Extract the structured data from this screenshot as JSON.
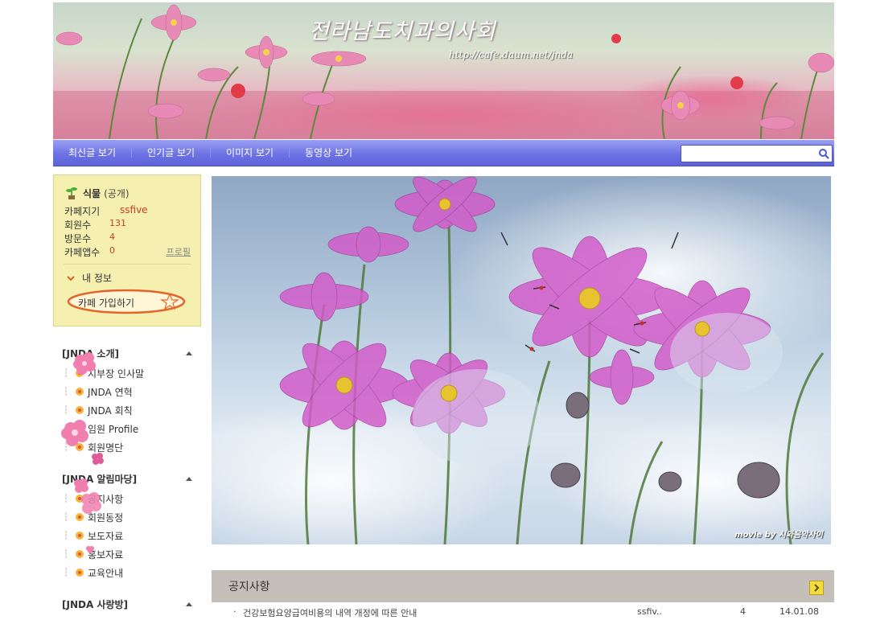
{
  "header": {
    "title": "전라남도치과의사회",
    "url": "http://cafe.daum.net/jnda"
  },
  "nav": {
    "items": [
      "최신글 보기",
      "인기글 보기",
      "이미지 보기",
      "동영상 보기"
    ],
    "search_placeholder": ""
  },
  "profile": {
    "level": "식물",
    "visibility": "(공개)",
    "rows": [
      {
        "label": "카페지기",
        "value": "ssfive"
      },
      {
        "label": "회원수",
        "value": "131"
      },
      {
        "label": "방문수",
        "value": "4"
      },
      {
        "label": "카페앱수",
        "value": "0"
      }
    ],
    "profile_link": "프로필",
    "my_info": "내 정보",
    "join_button": "카페 가입하기"
  },
  "sidebar": {
    "groups": [
      {
        "title": "[JNDA 소개]",
        "items": [
          "지부장 인사말",
          "JNDA 연혁",
          "JNDA 회칙",
          "임원 Profile",
          "회원명단"
        ]
      },
      {
        "title": "[JNDA 알림마당]",
        "items": [
          "공지사항",
          "회원동정",
          "보도자료",
          "홍보자료",
          "교육안내"
        ]
      },
      {
        "title": "[JNDA 사랑방]",
        "items": []
      }
    ]
  },
  "hero": {
    "credit": "movie by 시와음악사이"
  },
  "notice": {
    "title": "공지사항",
    "rows": [
      {
        "bullet": "·",
        "subject": "건강보험요양급여비용의 내역 개정에 따른 안내",
        "author": "ssfiv..",
        "views": "4",
        "date": "14.01.08"
      }
    ]
  },
  "colors": {
    "nav": "#6d73e4",
    "profile_bg": "#f6f0b0",
    "accent_value": "#d23a1e",
    "notice_bg": "#c4bfb9"
  }
}
